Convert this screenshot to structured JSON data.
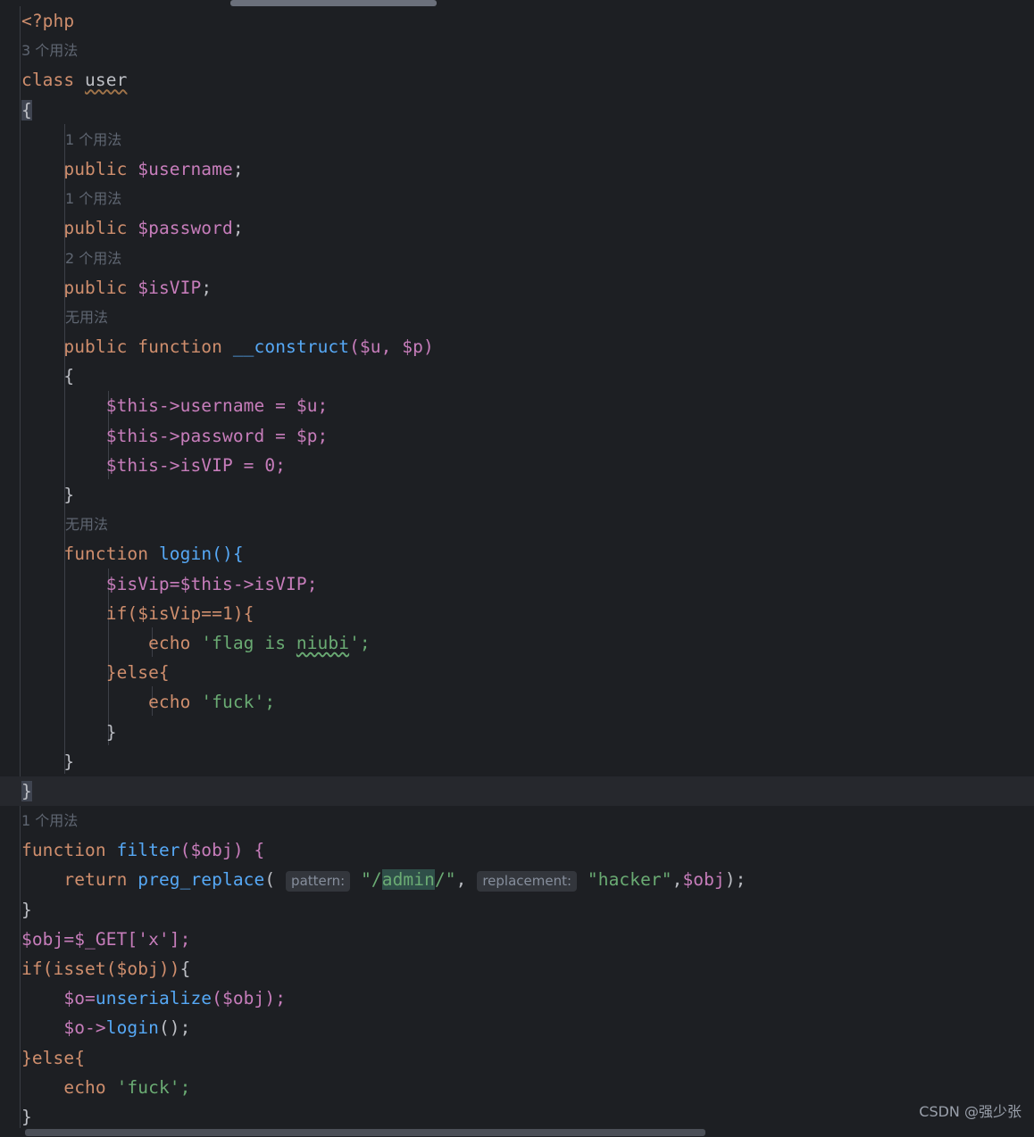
{
  "editor": {
    "language": "php",
    "theme": "dark",
    "background": "#1d1f23",
    "caret_line_background": "#26282d",
    "gutter_background": "#1d1f23",
    "colors": {
      "keyword": "#cf8e6d",
      "variable": "#c77dbb",
      "function": "#56a8f5",
      "string": "#6aab73",
      "number": "#2aacb8",
      "default_text": "#bcbec4",
      "inlay_hint_text": "#868e9c",
      "inlay_hint_background": "#33363c",
      "usage_hint": "#5f6672",
      "search_highlight": "#2f4f49",
      "brace_match_highlight": "#3f4450",
      "typo_squiggle": "#a1744a"
    }
  },
  "scrollbars": {
    "top": {
      "name": "horizontal-scrollbar-top",
      "thumb_color": "#6b707b",
      "thumb_left_pct": 22.3,
      "thumb_width_pct": 19.9
    },
    "bottom": {
      "name": "horizontal-scrollbar-bottom",
      "thumb_color": "#4b4f57",
      "thumb_left_pct": 2.4,
      "thumb_width_pct": 65.8
    }
  },
  "usage_hints": {
    "class_user": "3 个用法",
    "username": "1 个用法",
    "password": "1 个用法",
    "isvip": "2 个用法",
    "construct": "无用法",
    "login": "无用法",
    "filter": "1 个用法"
  },
  "inlay_hints": {
    "pattern": "pattern:",
    "replacement": "replacement:"
  },
  "code": {
    "l_open_tag": "<?php",
    "l_class_kw": "class",
    "l_class_name": "user",
    "l_brace_open": "{",
    "l_public": "public",
    "l_username_var": "$username",
    "l_password_var": "$password",
    "l_isvip_var": "$isVIP",
    "l_semicolon": ";",
    "l_function_kw": "function",
    "l_construct_name": "__construct",
    "l_construct_params": "($u, $p)",
    "l_this_username": "$this->username = $u;",
    "l_this_password": "$this->password = $p;",
    "l_this_isvip": "$this->isVIP = 0;",
    "l_login_sig": "login(){",
    "l_isvip_assign": "$isVip=$this->isVIP;",
    "l_if_isvip": "if($isVip==1){",
    "l_echo_flag_kw": "echo",
    "l_echo_flag_str_a": "'flag is ",
    "l_echo_flag_str_b": "niubi",
    "l_echo_flag_str_c": "';",
    "l_else_brace": "}else{",
    "l_echo_fuck_kw": "echo",
    "l_echo_fuck_str": "'fuck';",
    "l_brace_close": "}",
    "l_filter_kw": "function",
    "l_filter_name": "filter",
    "l_filter_params": "($obj) {",
    "l_return_kw": "return",
    "l_preg_replace": "preg_replace",
    "l_paren_open": "(",
    "l_pattern_quote_open": "\"/",
    "l_pattern_admin": "admin",
    "l_pattern_quote_close": "/\"",
    "l_comma1": ",",
    "l_replacement_str": "\"hacker\"",
    "l_comma2": ",",
    "l_obj_var": "$obj",
    "l_paren_close": ");",
    "l_obj_get": "$obj=$_GET['x'];",
    "l_if_isset": "if(isset($obj))",
    "l_brace_open2": "{",
    "l_o_unserialize_a": "$o=",
    "l_o_unserialize_b": "unserialize",
    "l_o_unserialize_c": "($obj);",
    "l_o_login_a": "$o->",
    "l_o_login_b": "login",
    "l_o_login_c": "();"
  },
  "watermark": "CSDN @强少张"
}
